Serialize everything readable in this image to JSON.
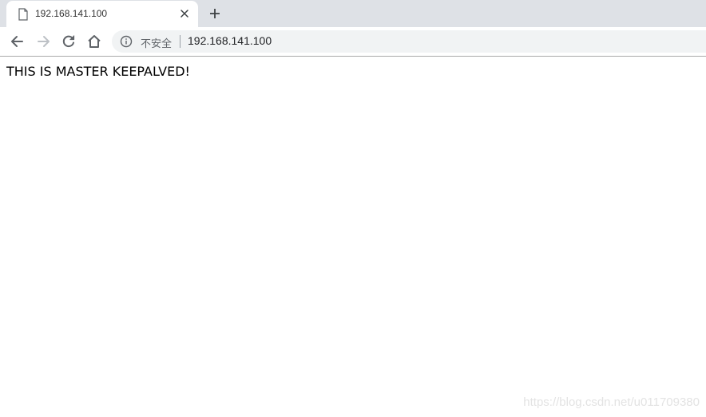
{
  "tab": {
    "title": "192.168.141.100",
    "favicon": "page-icon"
  },
  "toolbar": {
    "back_icon": "arrow-left-icon",
    "forward_icon": "arrow-right-icon",
    "reload_icon": "reload-icon",
    "home_icon": "home-icon"
  },
  "omnibox": {
    "security_text": "不安全",
    "url": "192.168.141.100"
  },
  "page": {
    "text": "THIS IS MASTER KEEPALVED!"
  },
  "watermark": {
    "text": "https://blog.csdn.net/u011709380"
  },
  "colors": {
    "tab_strip": "#dee1e6",
    "omnibox": "#f1f3f4",
    "icon": "#5f6368"
  }
}
